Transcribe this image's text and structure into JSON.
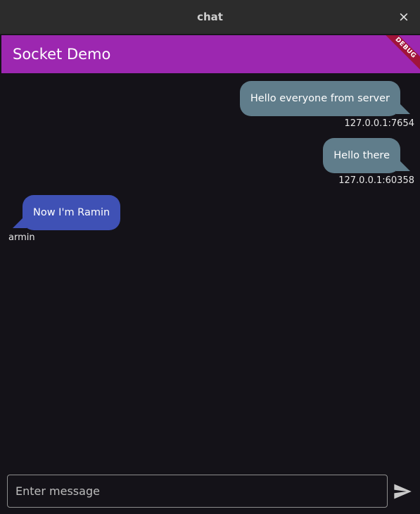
{
  "window": {
    "title": "chat",
    "close_glyph": "×"
  },
  "appbar": {
    "title": "Socket Demo",
    "debug_banner": "DEBUG",
    "color": "#9c27b0"
  },
  "messages": [
    {
      "text": "Hello everyone from server",
      "sender": "127.0.0.1:7654",
      "direction": "outgoing",
      "color": "#607d8b"
    },
    {
      "text": "Hello there",
      "sender": "127.0.0.1:60358",
      "direction": "outgoing",
      "color": "#607d8b"
    },
    {
      "text": "Now I'm Ramin",
      "sender": "armin",
      "direction": "incoming",
      "color": "#3f51b5"
    }
  ],
  "composer": {
    "input_value": "",
    "placeholder": "Enter message",
    "send_icon": "send-icon"
  }
}
